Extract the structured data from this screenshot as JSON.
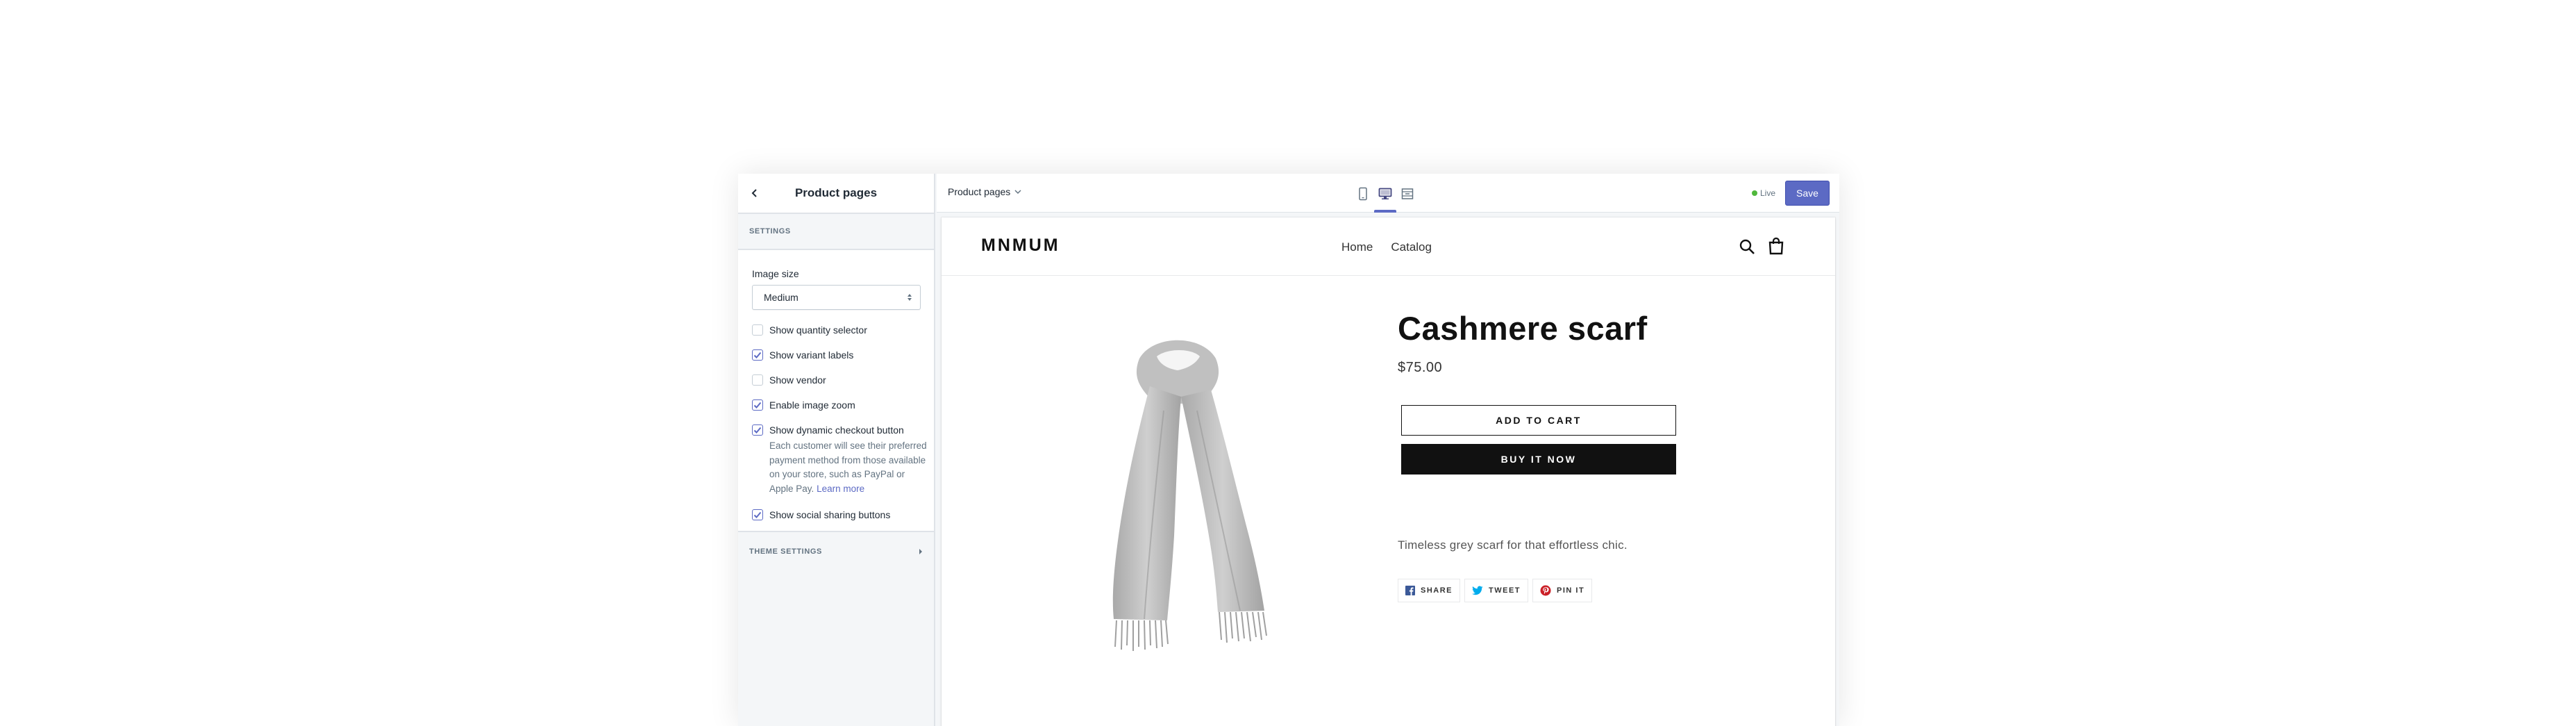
{
  "sidebar": {
    "title": "Product pages",
    "settings_heading": "SETTINGS",
    "image_size": {
      "label": "Image size",
      "value": "Medium"
    },
    "checkboxes": [
      {
        "label": "Show quantity selector",
        "checked": false
      },
      {
        "label": "Show variant labels",
        "checked": true
      },
      {
        "label": "Show vendor",
        "checked": false
      },
      {
        "label": "Enable image zoom",
        "checked": true
      },
      {
        "label": "Show dynamic checkout button",
        "checked": true
      },
      {
        "label": "Show social sharing buttons",
        "checked": true
      }
    ],
    "dynamic_checkout_help": "Each customer will see their preferred payment method from those available on your store, such as PayPal or Apple Pay.",
    "learn_more": "Learn more",
    "theme_settings_heading": "THEME SETTINGS"
  },
  "topbar": {
    "page_select": "Product pages",
    "devices": [
      "mobile-icon",
      "desktop-icon",
      "fullscreen-icon"
    ],
    "active_device": "desktop",
    "status": "Live",
    "save_label": "Save"
  },
  "store": {
    "logo": "MNMUM",
    "nav": [
      "Home",
      "Catalog"
    ],
    "product": {
      "title": "Cashmere scarf",
      "price": "$75.00",
      "add_to_cart": "ADD TO CART",
      "buy_now": "BUY IT NOW",
      "description": "Timeless grey scarf for that effortless chic."
    },
    "share": [
      "SHARE",
      "TWEET",
      "PIN IT"
    ]
  },
  "colors": {
    "accent": "#5c6ac4",
    "live": "#50b83c",
    "facebook": "#3b5998",
    "twitter": "#00aced",
    "pinterest": "#cb2027"
  }
}
